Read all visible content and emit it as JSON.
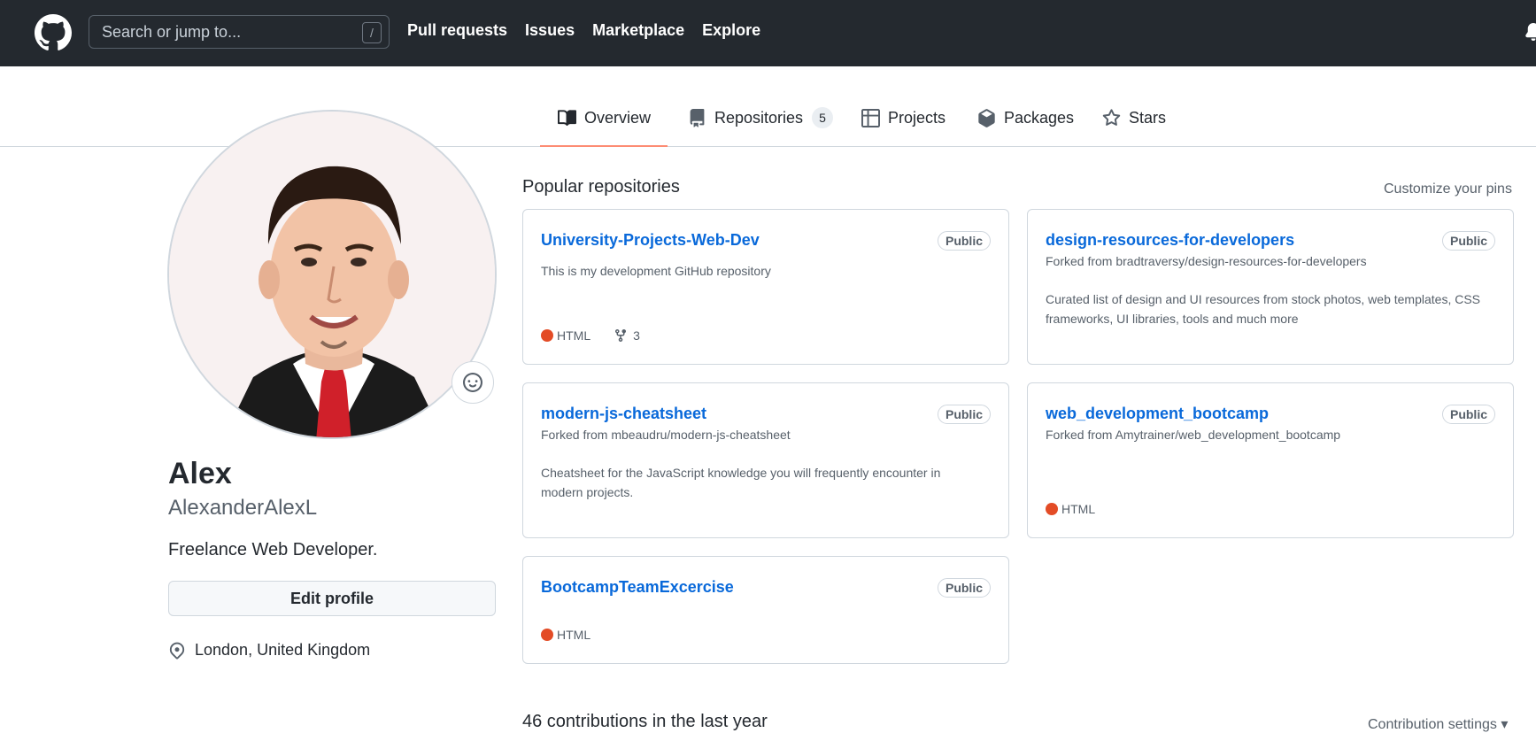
{
  "header": {
    "search_placeholder": "Search or jump to...",
    "search_shortcut": "/",
    "nav": [
      "Pull requests",
      "Issues",
      "Marketplace",
      "Explore"
    ]
  },
  "tabs": [
    {
      "label": "Overview",
      "icon": "book-icon",
      "active": true
    },
    {
      "label": "Repositories",
      "icon": "repo-icon",
      "count": "5"
    },
    {
      "label": "Projects",
      "icon": "table-icon"
    },
    {
      "label": "Packages",
      "icon": "package-icon"
    },
    {
      "label": "Stars",
      "icon": "star-icon"
    }
  ],
  "profile": {
    "name": "Alex",
    "login": "AlexanderAlexL",
    "bio": "Freelance Web Developer.",
    "edit_label": "Edit profile",
    "location": "London, United Kingdom"
  },
  "pinned": {
    "title": "Popular repositories",
    "customize": "Customize your pins",
    "repos": [
      {
        "name": "University-Projects-Web-Dev",
        "visibility": "Public",
        "description": "This is my development GitHub repository",
        "language": "HTML",
        "forks": "3"
      },
      {
        "name": "design-resources-for-developers",
        "visibility": "Public",
        "forked_from": "Forked from bradtraversy/design-resources-for-developers",
        "description": "Curated list of design and UI resources from stock photos, web templates, CSS frameworks, UI libraries, tools and much more"
      },
      {
        "name": "modern-js-cheatsheet",
        "visibility": "Public",
        "forked_from": "Forked from mbeaudru/modern-js-cheatsheet",
        "description": "Cheatsheet for the JavaScript knowledge you will frequently encounter in modern projects."
      },
      {
        "name": "web_development_bootcamp",
        "visibility": "Public",
        "forked_from": "Forked from Amytrainer/web_development_bootcamp",
        "language": "HTML"
      },
      {
        "name": "BootcampTeamExcercise",
        "visibility": "Public",
        "language": "HTML"
      }
    ]
  },
  "contributions": {
    "heading": "46 contributions in the last year",
    "settings": "Contribution settings"
  },
  "colors": {
    "header_bg": "#24292f",
    "link": "#0969da",
    "html_lang": "#e34c26",
    "active_tab": "#fd8c73"
  }
}
